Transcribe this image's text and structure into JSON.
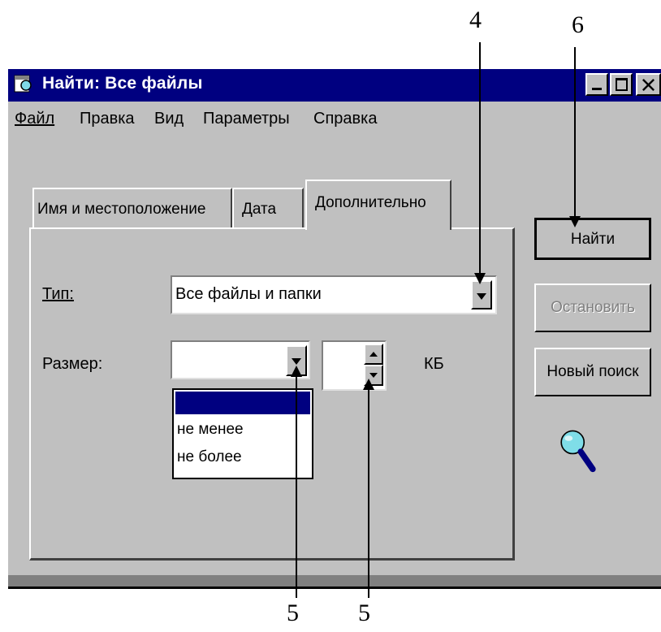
{
  "callouts": [
    "4",
    "6",
    "5",
    "5"
  ],
  "window": {
    "title": "Найти: Все файлы",
    "controls": [
      "_",
      "□",
      "x"
    ]
  },
  "menu": [
    "Файл",
    "Правка",
    "Вид",
    "Параметры",
    "Справка"
  ],
  "tabs": [
    "Имя и местоположение",
    "Дата",
    "Дополнительно"
  ],
  "active_tab": "Дополнительно",
  "form": {
    "type_label": "Тип:",
    "type_value": "Все файлы и папки",
    "size_label": "Размер:",
    "size_value": "",
    "size_amount": "",
    "size_unit": "КБ",
    "size_options": [
      "",
      "не менее",
      "не более"
    ]
  },
  "buttons": {
    "find": "Найти",
    "stop": "Остановить",
    "new_search": "Новый поиск"
  },
  "icons": [
    "search-window-icon",
    "magnifier-icon",
    "dropdown-arrow-icon",
    "spinner-up-icon",
    "spinner-down-icon"
  ]
}
